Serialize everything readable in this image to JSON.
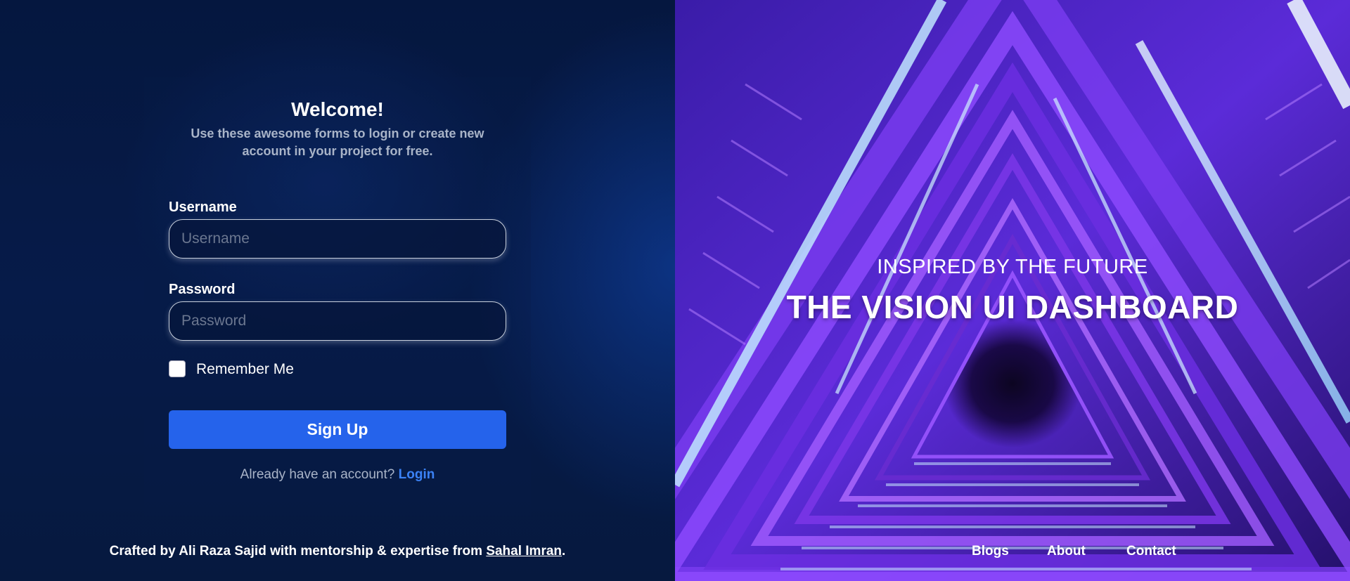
{
  "form": {
    "title": "Welcome!",
    "subtitle": "Use these awesome forms to login or create new account in your project for free.",
    "username_label": "Username",
    "username_placeholder": "Username",
    "password_label": "Password",
    "password_placeholder": "Password",
    "remember_label": "Remember Me",
    "submit_label": "Sign Up",
    "already_text": "Already have an account?",
    "login_link": "Login"
  },
  "footer": {
    "credit_prefix": "Crafted by Ali Raza Sajid with mentorship & expertise from",
    "credit_name": "Sahal Imran",
    "credit_suffix": ".",
    "links": [
      "Blogs",
      "About",
      "Contact"
    ]
  },
  "hero": {
    "eyebrow": "INSPIRED BY THE FUTURE",
    "title": "THE VISION UI DASHBOARD"
  }
}
